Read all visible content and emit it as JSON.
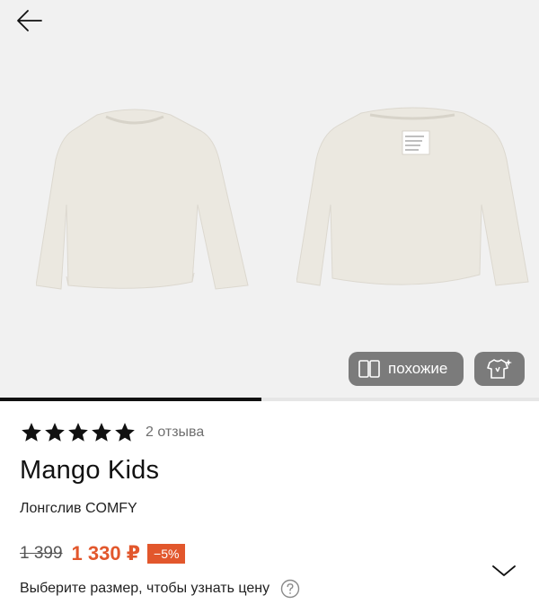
{
  "gallery": {
    "images": [
      {
        "name": "product-front-photo",
        "alt": "front"
      },
      {
        "name": "product-back-photo",
        "alt": "back"
      }
    ],
    "similar_label": "похожие",
    "progress": 0.485,
    "colors": {
      "background": "#f1f1f1",
      "chip": "#7b7b7b",
      "garment": "#ebe8e0"
    }
  },
  "product": {
    "rating": 5,
    "reviews_label": "2 отзыва",
    "brand": "Mango Kids",
    "name": "Лонгслив COMFY",
    "old_price": "1 399",
    "new_price": "1 330 ₽",
    "discount": "−5%",
    "size_hint": "Выберите размер, чтобы узнать цену"
  },
  "colors": {
    "accent": "#e2572c",
    "text": "#1a1a1a",
    "muted": "#6f6f6f"
  }
}
